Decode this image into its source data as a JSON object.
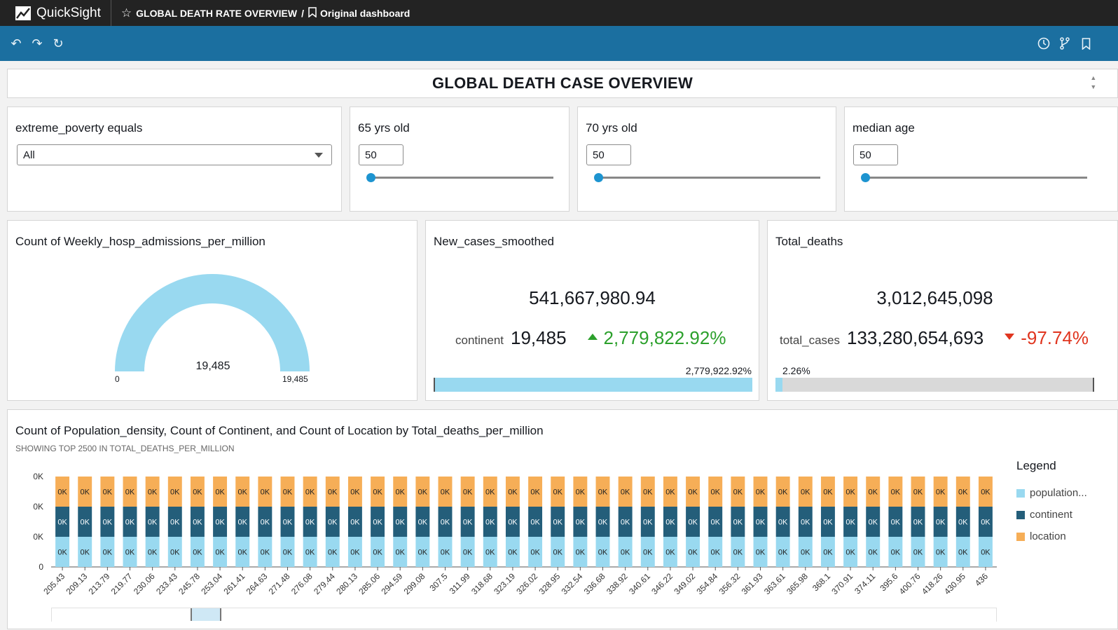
{
  "app": {
    "name": "QuickSight"
  },
  "breadcrumb": {
    "analysis": "GLOBAL DEATH RATE OVERVIEW",
    "separator": "/",
    "dashboard": "Original dashboard"
  },
  "title": "GLOBAL DEATH CASE OVERVIEW",
  "controls": {
    "poverty": {
      "title": "extreme_poverty equals",
      "value": "All"
    },
    "age65": {
      "title": "65 yrs old",
      "value": "50"
    },
    "age70": {
      "title": "70 yrs old",
      "value": "50"
    },
    "median": {
      "title": "median age",
      "value": "50"
    }
  },
  "gauge": {
    "title": "Count of Weekly_hosp_admissions_per_million",
    "value": "19,485",
    "min": "0",
    "max": "19,485",
    "fill_fraction": 1.0
  },
  "kpi_cases": {
    "title": "New_cases_smoothed",
    "value": "541,667,980.94",
    "compare_label": "continent",
    "compare_value": "19,485",
    "change": "2,779,822.92%",
    "bar_label": "2,779,922.92%",
    "bar_fraction": 1.0
  },
  "kpi_deaths": {
    "title": "Total_deaths",
    "value": "3,012,645,098",
    "compare_label": "total_cases",
    "compare_value": "133,280,654,693",
    "change": "-97.74%",
    "bar_label": "2.26%",
    "bar_fraction": 0.0226
  },
  "colors": {
    "population": "#99d9f0",
    "continent": "#245e7a",
    "location": "#f6ae57",
    "accent": "#1b6fa0"
  },
  "chart_data": {
    "type": "bar",
    "title": "Count of Population_density, Count of Continent, and Count of Location by Total_deaths_per_million",
    "subtitle": "SHOWING TOP 2500 IN TOTAL_DEATHS_PER_MILLION",
    "y_ticks": [
      "0",
      "0K",
      "0K",
      "0K"
    ],
    "bar_value_label": "0K",
    "categories": [
      "205.43",
      "209.13",
      "213.79",
      "219.77",
      "230.06",
      "233.43",
      "245.78",
      "253.04",
      "261.41",
      "264.63",
      "271.48",
      "276.08",
      "279.44",
      "280.13",
      "285.06",
      "294.59",
      "299.08",
      "307.5",
      "311.99",
      "318.68",
      "323.19",
      "326.02",
      "328.95",
      "332.54",
      "336.68",
      "338.92",
      "340.61",
      "346.22",
      "349.02",
      "354.84",
      "356.32",
      "361.93",
      "363.61",
      "365.98",
      "368.1",
      "370.91",
      "374.11",
      "395.6",
      "400.76",
      "418.26",
      "430.95",
      "436"
    ],
    "series": [
      {
        "name": "population...",
        "key": "population",
        "values": [
          1,
          1,
          1,
          1,
          1,
          1,
          1,
          1,
          1,
          1,
          1,
          1,
          1,
          1,
          1,
          1,
          1,
          1,
          1,
          1,
          1,
          1,
          1,
          1,
          1,
          1,
          1,
          1,
          1,
          1,
          1,
          1,
          1,
          1,
          1,
          1,
          1,
          1,
          1,
          1,
          1,
          1
        ]
      },
      {
        "name": "continent",
        "key": "continent",
        "values": [
          1,
          1,
          1,
          1,
          1,
          1,
          1,
          1,
          1,
          1,
          1,
          1,
          1,
          1,
          1,
          1,
          1,
          1,
          1,
          1,
          1,
          1,
          1,
          1,
          1,
          1,
          1,
          1,
          1,
          1,
          1,
          1,
          1,
          1,
          1,
          1,
          1,
          1,
          1,
          1,
          1,
          1
        ]
      },
      {
        "name": "location",
        "key": "location",
        "values": [
          1,
          1,
          1,
          1,
          1,
          1,
          1,
          1,
          1,
          1,
          1,
          1,
          1,
          1,
          1,
          1,
          1,
          1,
          1,
          1,
          1,
          1,
          1,
          1,
          1,
          1,
          1,
          1,
          1,
          1,
          1,
          1,
          1,
          1,
          1,
          1,
          1,
          1,
          1,
          1,
          1,
          1
        ]
      }
    ],
    "legend": {
      "title": "Legend",
      "position": "right"
    }
  }
}
